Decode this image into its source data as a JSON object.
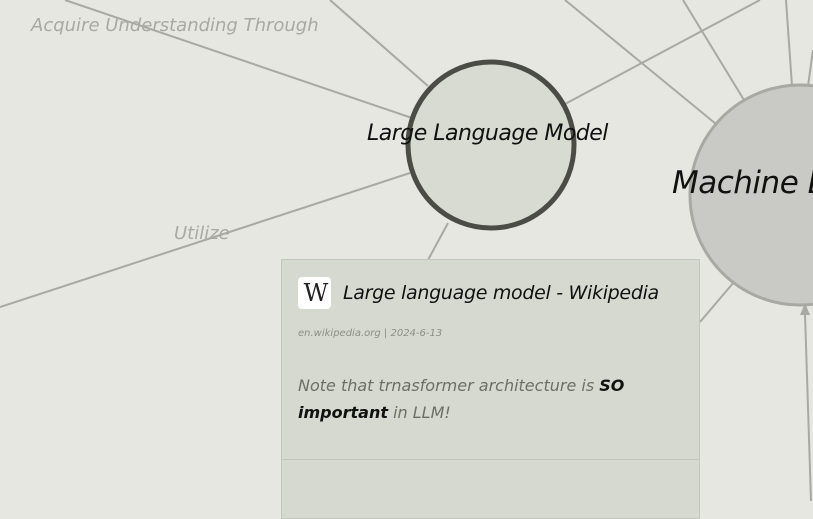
{
  "edges": {
    "acquire_label": "Acquire Understanding Through",
    "utilize_label": "Utilize"
  },
  "nodes": {
    "llm": {
      "label": "Large Language Model"
    },
    "ml": {
      "label": "Machine L"
    }
  },
  "card": {
    "icon": "wikipedia-icon",
    "logo_text": "W",
    "title": "Large language model - Wikipedia",
    "source": "en.wikipedia.org",
    "separator": "|",
    "date": "2024-6-13",
    "note_before": "Note that trnasformer architecture is ",
    "note_emphasis": "SO important",
    "note_after": " in LLM!"
  },
  "colors": {
    "background": "#e7e7e1",
    "edge": "#a9a9a3",
    "llm_fill": "#d8dbd1",
    "llm_stroke": "#4c4c46",
    "ml_fill": "#c9c9c6",
    "card_fill": "#d6d9d0"
  }
}
